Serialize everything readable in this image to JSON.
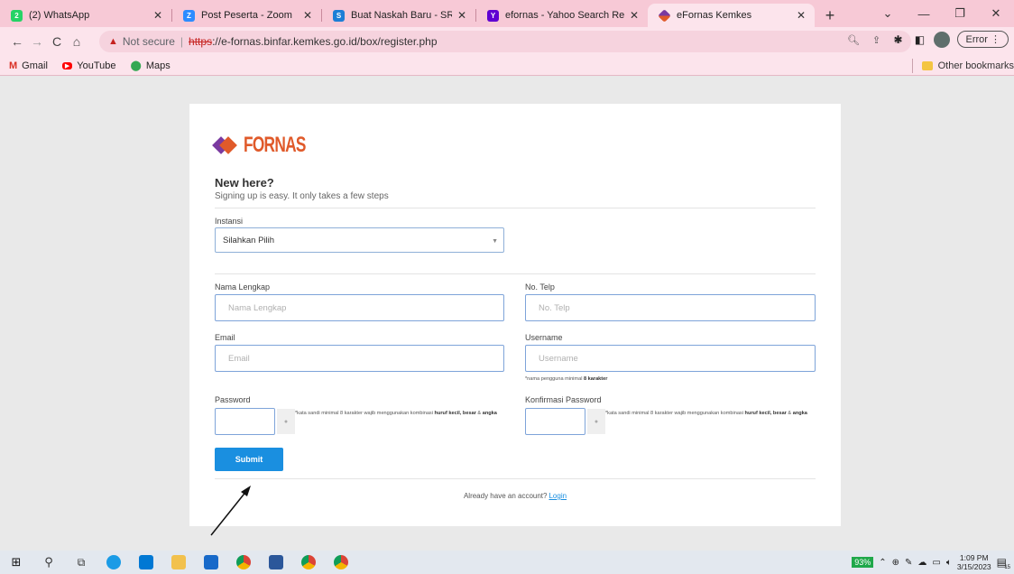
{
  "browser": {
    "tabs": [
      {
        "title": "(2) WhatsApp",
        "color": "#25d366",
        "glyph": "2"
      },
      {
        "title": "Post Peserta - Zoom",
        "color": "#2d8cff",
        "glyph": "Z"
      },
      {
        "title": "Buat Naskah Baru - SRIKANDI",
        "color": "#1c7ed6",
        "glyph": "S"
      },
      {
        "title": "efornas - Yahoo Search Results",
        "color": "#6001d2",
        "glyph": "Y"
      },
      {
        "title": "eFornas Kemkes",
        "color": "#e05a2a",
        "glyph": "",
        "active": true
      }
    ],
    "address": {
      "not_secure": "Not secure",
      "protocol": "https",
      "url_rest": "://e-fornas.binfar.kemkes.go.id/box/register.php"
    },
    "error_label": "Error",
    "bookmarks": [
      {
        "label": "Gmail",
        "color": "#d93025",
        "glyph": "M"
      },
      {
        "label": "YouTube",
        "color": "#ff0000",
        "glyph": "▶"
      },
      {
        "label": "Maps",
        "color": "#34a853",
        "glyph": "⬤"
      }
    ],
    "other_bookmarks": "Other bookmarks"
  },
  "form": {
    "logo_text": "FORNAS",
    "heading": "New here?",
    "subheading": "Signing up is easy. It only takes a few steps",
    "instansi_label": "Instansi",
    "instansi_value": "Silahkan Pilih",
    "nama_label": "Nama Lengkap",
    "nama_placeholder": "Nama Lengkap",
    "telp_label": "No. Telp",
    "telp_placeholder": "No. Telp",
    "email_label": "Email",
    "email_placeholder": "Email",
    "username_label": "Username",
    "username_placeholder": "Username",
    "username_hint_pre": "*nama pengguna minimal ",
    "username_hint_bold": "8 karakter",
    "password_label": "Password",
    "konfirmasi_label": "Konfirmasi Password",
    "pw_hint_pre": "*kata sandi minimal 8 karakter wajib menggunakan kombinasi ",
    "pw_hint_b1": "huruf kecil, besar",
    "pw_hint_amp": " & ",
    "pw_hint_b2": "angka",
    "submit_label": "Submit",
    "footer_text": "Already have an account?",
    "login_link": "Login"
  },
  "taskbar": {
    "battery": "93%",
    "time": "1:09 PM",
    "date": "3/15/2023",
    "notifications": "15"
  }
}
